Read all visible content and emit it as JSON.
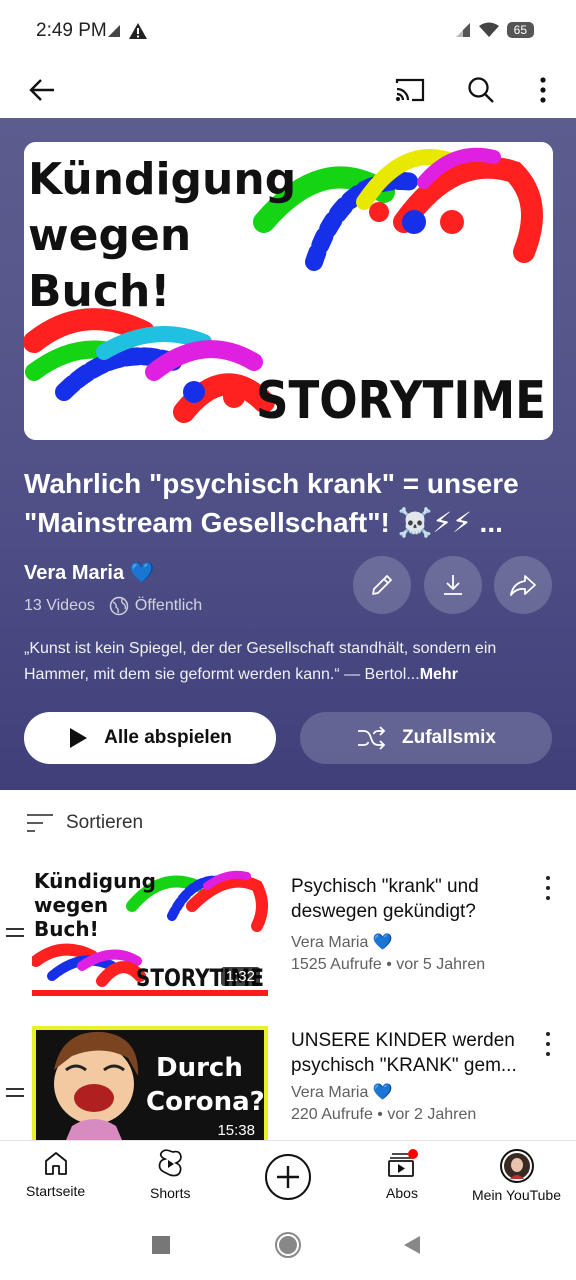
{
  "status": {
    "time": "2:49 PM",
    "battery": "65"
  },
  "playlist": {
    "thumb_text": {
      "line1": "Kündigung",
      "line2": "wegen",
      "line3": "Buch!",
      "storytime": "STORYTIME"
    },
    "title": "Wahrlich \"psychisch krank\" = unsere \"Mainstream Gesellschaft\"! ☠️⚡⚡ ...",
    "owner": "Vera Maria 💙",
    "video_count": "13 Videos",
    "visibility": "Öffentlich",
    "description": "„Kunst ist kein Spiegel, der der Gesellschaft standhält, sondern ein Hammer, mit dem sie geformt werden kann.“ —  Bertol...",
    "more_label": "Mehr",
    "play_all_label": "Alle abspielen",
    "shuffle_label": "Zufallsmix"
  },
  "sort_label": "Sortieren",
  "videos": [
    {
      "title": "Psychisch \"krank\" und deswegen gekündigt?",
      "channel": "Vera Maria 💙",
      "meta": "1525 Aufrufe • vor 5 Jahren",
      "duration": "1:32",
      "thumb_text": {
        "line1": "Kündigung",
        "line2": "wegen",
        "line3": "Buch!",
        "storytime": "STORYTIME"
      }
    },
    {
      "title_line1": "UNSERE KINDER werden",
      "title_line2": "psychisch \"KRANK\" gem...",
      "channel": "Vera Maria 💙",
      "meta": "220 Aufrufe • vor 2 Jahren",
      "duration": "15:38",
      "thumb_text": {
        "line1": "Durch",
        "line2": "Corona?"
      }
    }
  ],
  "nav": {
    "home": "Startseite",
    "shorts": "Shorts",
    "subs": "Abos",
    "you": "Mein YouTube"
  },
  "colors": {
    "hero_bg": "#56578b",
    "accent_red": "#ff0000"
  }
}
